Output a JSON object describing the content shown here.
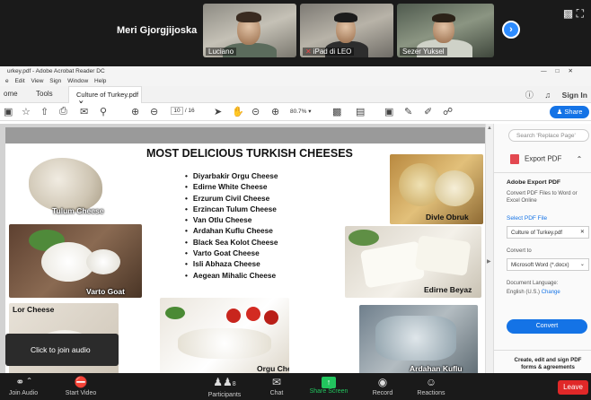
{
  "zoom": {
    "active_speaker": "Meri Gjorgjijoska",
    "participants": [
      {
        "name": "Luciano",
        "muted": false
      },
      {
        "name": "iPad di LEO",
        "muted": true
      },
      {
        "name": "Sezer Yuksel",
        "muted": false
      }
    ],
    "bottom_bar": {
      "join_audio": "Join Audio",
      "start_video": "Start Video",
      "participants": "Participants",
      "participants_count": "8",
      "chat": "Chat",
      "share_screen": "Share Screen",
      "record": "Record",
      "reactions": "Reactions",
      "leave": "Leave"
    },
    "join_audio_tooltip": "Click to join audio"
  },
  "acrobat": {
    "window_title": "urkey.pdf - Adobe Acrobat Reader DC",
    "menu": [
      "e",
      "Edit",
      "View",
      "Sign",
      "Window",
      "Help"
    ],
    "tabs": {
      "home": "ome",
      "tools": "Tools",
      "document": "Culture of Turkey.pdf"
    },
    "sign_in": "Sign In",
    "share": "Share",
    "page_current": "10",
    "page_total": "/ 16",
    "zoom_level": "80.7%"
  },
  "slide": {
    "title": "MOST DELICIOUS TURKISH CHEESES",
    "cheeses": [
      "Diyarbakir Orgu Cheese",
      "Edirne White Cheese",
      "Erzurum Civil Cheese",
      "Erzincan Tulum Cheese",
      "Van Otlu Cheese",
      "Ardahan Kuflu Cheese",
      "Black Sea Kolot Cheese",
      "Varto Goat Cheese",
      "Isli Abhaza Cheese",
      "Aegean Mihalic Cheese"
    ],
    "image_labels": {
      "tulum": "Tulum Cheese",
      "divle": "Divle Obruk",
      "varto": "Varto Goat",
      "edirne": "Edirne Beyaz",
      "lor": "Lor Cheese",
      "orgu": "Orgu Cheese",
      "ardahan": "Ardahan Kuflu"
    }
  },
  "right_pane": {
    "search_placeholder": "Search 'Replace Page'",
    "export_pdf": "Export PDF",
    "heading": "Adobe Export PDF",
    "description": "Convert PDF Files to Word or Excel Online",
    "select_file": "Select PDF File",
    "file_name": "Culture of Turkey.pdf",
    "convert_to_label": "Convert to",
    "convert_to_value": "Microsoft Word (*.docx)",
    "doc_lang_label": "Document Language:",
    "doc_lang_value": "English (U.S.)",
    "change": "Change",
    "convert": "Convert",
    "promo": "Create, edit and sign PDF forms & agreements"
  }
}
